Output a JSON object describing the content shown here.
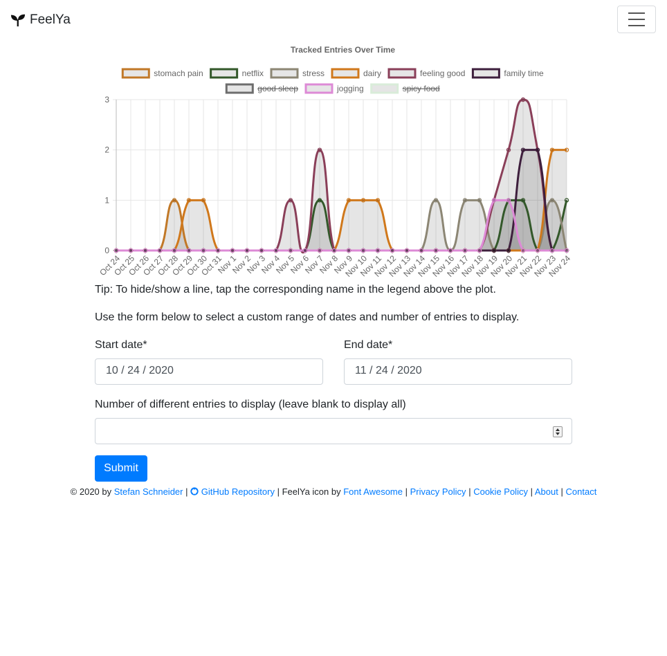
{
  "navbar": {
    "brand": "FeelYa"
  },
  "chart_data": {
    "type": "line",
    "title": "Tracked Entries Over Time",
    "x": [
      "Oct 24",
      "Oct 25",
      "Oct 26",
      "Oct 27",
      "Oct 28",
      "Oct 29",
      "Oct 30",
      "Oct 31",
      "Nov 1",
      "Nov 2",
      "Nov 3",
      "Nov 4",
      "Nov 5",
      "Nov 6",
      "Nov 7",
      "Nov 8",
      "Nov 9",
      "Nov 10",
      "Nov 11",
      "Nov 12",
      "Nov 13",
      "Nov 14",
      "Nov 15",
      "Nov 16",
      "Nov 17",
      "Nov 18",
      "Nov 19",
      "Nov 20",
      "Nov 21",
      "Nov 22",
      "Nov 23",
      "Nov 24"
    ],
    "ylim": [
      0,
      3
    ],
    "y_ticks": [
      "0",
      "1",
      "2",
      "3"
    ],
    "grid": true,
    "legend_position": "top",
    "series": [
      {
        "name": "stomach pain",
        "color": "#c17827",
        "hidden": false,
        "values": [
          0,
          0,
          0,
          0,
          1,
          0,
          0,
          0,
          0,
          0,
          0,
          0,
          0,
          0,
          0,
          0,
          0,
          0,
          0,
          0,
          0,
          0,
          0,
          0,
          0,
          0,
          0,
          0,
          0,
          0,
          0,
          0
        ]
      },
      {
        "name": "netflix",
        "color": "#33582a",
        "hidden": false,
        "values": [
          0,
          0,
          0,
          0,
          0,
          0,
          0,
          0,
          0,
          0,
          0,
          0,
          0,
          0,
          1,
          0,
          0,
          0,
          0,
          0,
          0,
          0,
          0,
          0,
          0,
          0,
          0,
          1,
          1,
          0,
          0,
          1
        ]
      },
      {
        "name": "stress",
        "color": "#8c8674",
        "hidden": false,
        "values": [
          0,
          0,
          0,
          0,
          0,
          0,
          0,
          0,
          0,
          0,
          0,
          0,
          0,
          0,
          0,
          0,
          0,
          0,
          0,
          0,
          0,
          0,
          1,
          0,
          1,
          1,
          0,
          0,
          0,
          0,
          1,
          0
        ]
      },
      {
        "name": "dairy",
        "color": "#d0781b",
        "hidden": false,
        "values": [
          0,
          0,
          0,
          0,
          0,
          1,
          1,
          0,
          0,
          0,
          0,
          0,
          0,
          0,
          0,
          0,
          1,
          1,
          1,
          0,
          0,
          0,
          0,
          0,
          0,
          0,
          0,
          0,
          0,
          0,
          2,
          2
        ]
      },
      {
        "name": "feeling good",
        "color": "#8a3f59",
        "hidden": false,
        "values": [
          0,
          0,
          0,
          0,
          0,
          0,
          0,
          0,
          0,
          0,
          0,
          0,
          1,
          0,
          2,
          0,
          0,
          0,
          0,
          0,
          0,
          0,
          0,
          0,
          0,
          0,
          1,
          2,
          3,
          2,
          0,
          0
        ]
      },
      {
        "name": "family time",
        "color": "#3e1f3d",
        "hidden": false,
        "values": [
          0,
          0,
          0,
          0,
          0,
          0,
          0,
          0,
          0,
          0,
          0,
          0,
          0,
          0,
          0,
          0,
          0,
          0,
          0,
          0,
          0,
          0,
          0,
          0,
          0,
          0,
          0,
          0,
          2,
          2,
          0,
          0
        ]
      },
      {
        "name": "good sleep",
        "color": "#6d6d6d",
        "hidden": true,
        "values": []
      },
      {
        "name": "jogging",
        "color": "#dd8ad6",
        "hidden": false,
        "values": [
          0,
          0,
          0,
          0,
          0,
          0,
          0,
          0,
          0,
          0,
          0,
          0,
          0,
          0,
          0,
          0,
          0,
          0,
          0,
          0,
          0,
          0,
          0,
          0,
          0,
          0,
          1,
          1,
          0,
          0,
          0,
          0
        ]
      },
      {
        "name": "spicy food",
        "color": "#d9ecd9",
        "hidden": true,
        "values": []
      }
    ]
  },
  "tips": {
    "line1": "Tip: To hide/show a line, tap the corresponding name in the legend above the plot.",
    "line2": "Use the form below to select a custom range of dates and number of entries to display."
  },
  "form": {
    "start_label": "Start date*",
    "start_value": "10 / 24 / 2020",
    "end_label": "End date*",
    "end_value": "11 / 24 / 2020",
    "num_label": "Number of different entries to display (leave blank to display all)",
    "num_value": "",
    "submit_label": "Submit"
  },
  "footer": {
    "copy": "© 2020 by",
    "author": "Stefan Schneider",
    "sep1": "|",
    "github": "GitHub Repository",
    "icon_by": "| FeelYa icon by",
    "fa": "Font Awesome",
    "sep2": "|",
    "privacy": "Privacy Policy",
    "sep3": "|",
    "cookie": "Cookie Policy",
    "sep4": "|",
    "about": "About",
    "sep5": "|",
    "contact": "Contact"
  }
}
